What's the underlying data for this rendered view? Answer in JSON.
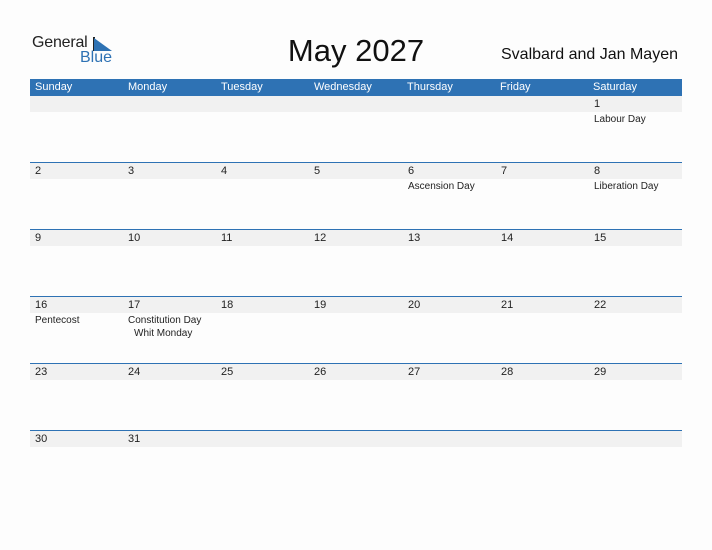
{
  "logo": {
    "general": "General",
    "blue": "Blue"
  },
  "title": "May 2027",
  "region": "Svalbard and Jan Mayen",
  "colors": {
    "accent": "#2e72b4",
    "band": "#f1f1f1"
  },
  "weekdays": [
    "Sunday",
    "Monday",
    "Tuesday",
    "Wednesday",
    "Thursday",
    "Friday",
    "Saturday"
  ],
  "weeks": [
    {
      "days": [
        "",
        "",
        "",
        "",
        "",
        "",
        "1"
      ],
      "events": {
        "6": [
          "Labour Day"
        ]
      }
    },
    {
      "days": [
        "2",
        "3",
        "4",
        "5",
        "6",
        "7",
        "8"
      ],
      "events": {
        "4": [
          "Ascension Day"
        ],
        "6": [
          "Liberation Day"
        ]
      }
    },
    {
      "days": [
        "9",
        "10",
        "11",
        "12",
        "13",
        "14",
        "15"
      ],
      "events": {}
    },
    {
      "days": [
        "16",
        "17",
        "18",
        "19",
        "20",
        "21",
        "22"
      ],
      "events": {
        "0": [
          "Pentecost"
        ],
        "1": [
          "Constitution Day",
          "Whit Monday"
        ]
      }
    },
    {
      "days": [
        "23",
        "24",
        "25",
        "26",
        "27",
        "28",
        "29"
      ],
      "events": {}
    },
    {
      "days": [
        "30",
        "31",
        "",
        "",
        "",
        "",
        ""
      ],
      "events": {}
    }
  ]
}
